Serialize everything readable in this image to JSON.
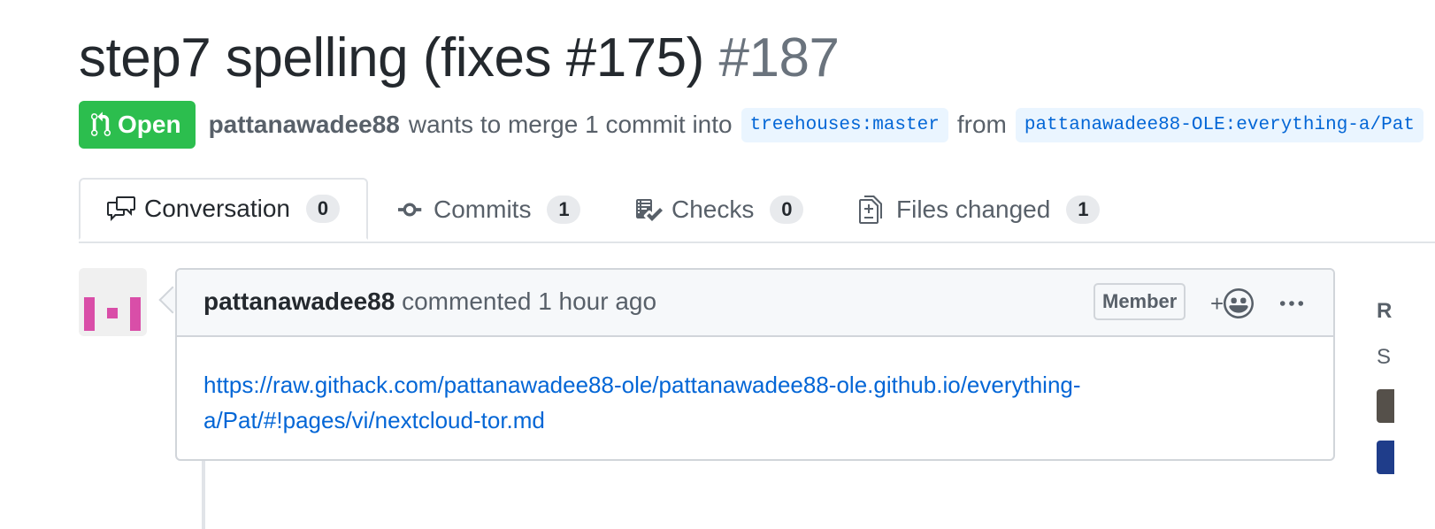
{
  "pull_request": {
    "title": "step7 spelling (fixes #175)",
    "number": "#187",
    "state": "Open",
    "author": "pattanawadee88",
    "merge_text": "wants to merge 1 commit into",
    "base_branch": "treehouses:master",
    "from_text": "from",
    "head_branch": "pattanawadee88-OLE:everything-a/Pat"
  },
  "tabs": [
    {
      "label": "Conversation",
      "count": "0",
      "icon": "comment-discussion-icon"
    },
    {
      "label": "Commits",
      "count": "1",
      "icon": "git-commit-icon"
    },
    {
      "label": "Checks",
      "count": "0",
      "icon": "checklist-icon"
    },
    {
      "label": "Files changed",
      "count": "1",
      "icon": "diff-icon"
    }
  ],
  "comment": {
    "author": "pattanawadee88",
    "action": "commented",
    "time": "1 hour ago",
    "role": "Member",
    "reaction_label": "+",
    "body_link": "https://raw.githack.com/pattanawadee88-ole/pattanawadee88-ole.github.io/everything-a/Pat/#!pages/vi/nextcloud-tor.md"
  },
  "sidebar_peek": {
    "heading_initial": "R",
    "sub_initial": "S"
  },
  "colors": {
    "open_green": "#2cbe4e",
    "link_blue": "#0366d6",
    "branch_bg": "#eaf5ff",
    "avatar_magenta": "#d94ea8"
  }
}
